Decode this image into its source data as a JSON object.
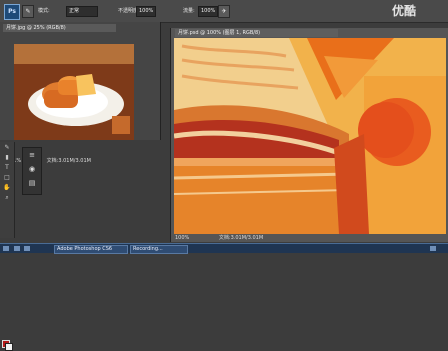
{
  "watermark": "优酷",
  "options_bar": {
    "app_badge": "Ps",
    "items": [
      "模式:",
      "正常",
      "不透明度:",
      "100%",
      "流量:",
      "100%"
    ],
    "zoom_value": "100%"
  },
  "left_doc": {
    "tab_title": "月饼.jpg @ 25% (RGB/8)",
    "zoom": "25.01%",
    "status": "文档:3.01M/3.01M"
  },
  "right_doc": {
    "tab_title": "月饼.psd @ 100% (图层 1, RGB/8)",
    "zoom": "100%",
    "status": "文档:3.01M/3.01M"
  },
  "tools": [
    "brush-icon",
    "eraser-icon",
    "text-icon",
    "rectangle-icon",
    "hand-icon",
    "zoom-icon"
  ],
  "taskbar": {
    "items": [
      "Adobe Photoshop CS6",
      "Recording..."
    ]
  },
  "colors": {
    "foreground": "#b21919",
    "background": "#f2f2f2"
  }
}
